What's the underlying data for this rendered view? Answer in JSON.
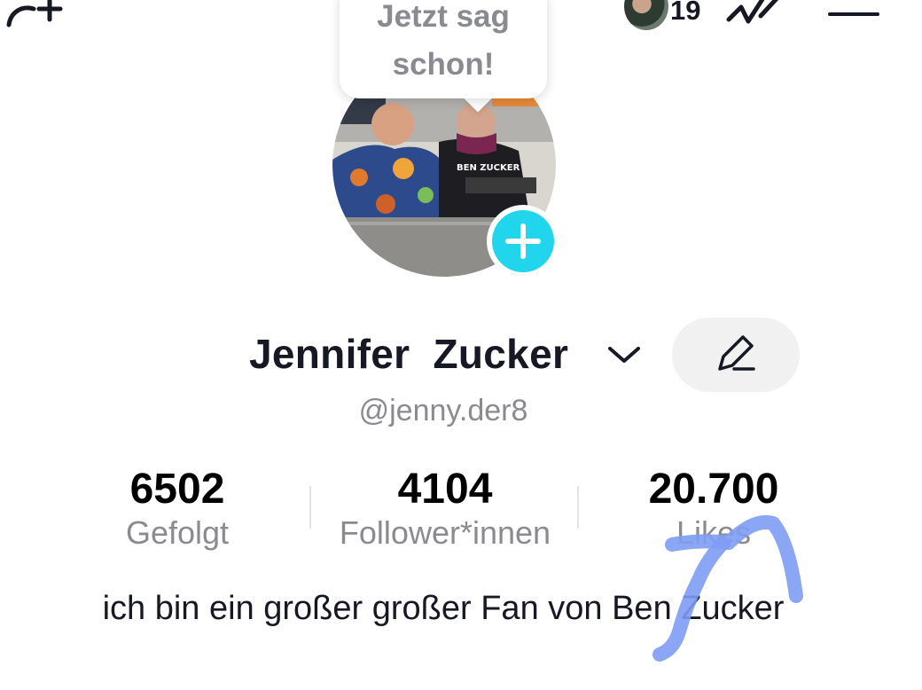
{
  "top_bar": {
    "add_friend_icon": "person-add-icon",
    "notification_count": "19",
    "activity_icon": "activity-icon",
    "menu_icon": "hamburger-menu-icon"
  },
  "tooltip": {
    "text": "Jetzt sag schon!"
  },
  "profile": {
    "display_name": "Jennifer  Zucker",
    "handle": "@jenny.der8",
    "edit_icon": "pencil-icon",
    "add_story_icon": "plus-icon"
  },
  "stats": [
    {
      "value": "6502",
      "label": "Gefolgt"
    },
    {
      "value": "4104",
      "label": "Follower*innen"
    },
    {
      "value": "20.700",
      "label": "Likes"
    }
  ],
  "bio": "ich bin ein großer großer Fan von Ben Zucker",
  "colors": {
    "accent": "#20d5ec",
    "secondary_text": "#8a8b91",
    "scribble": "#7f9cf5"
  }
}
